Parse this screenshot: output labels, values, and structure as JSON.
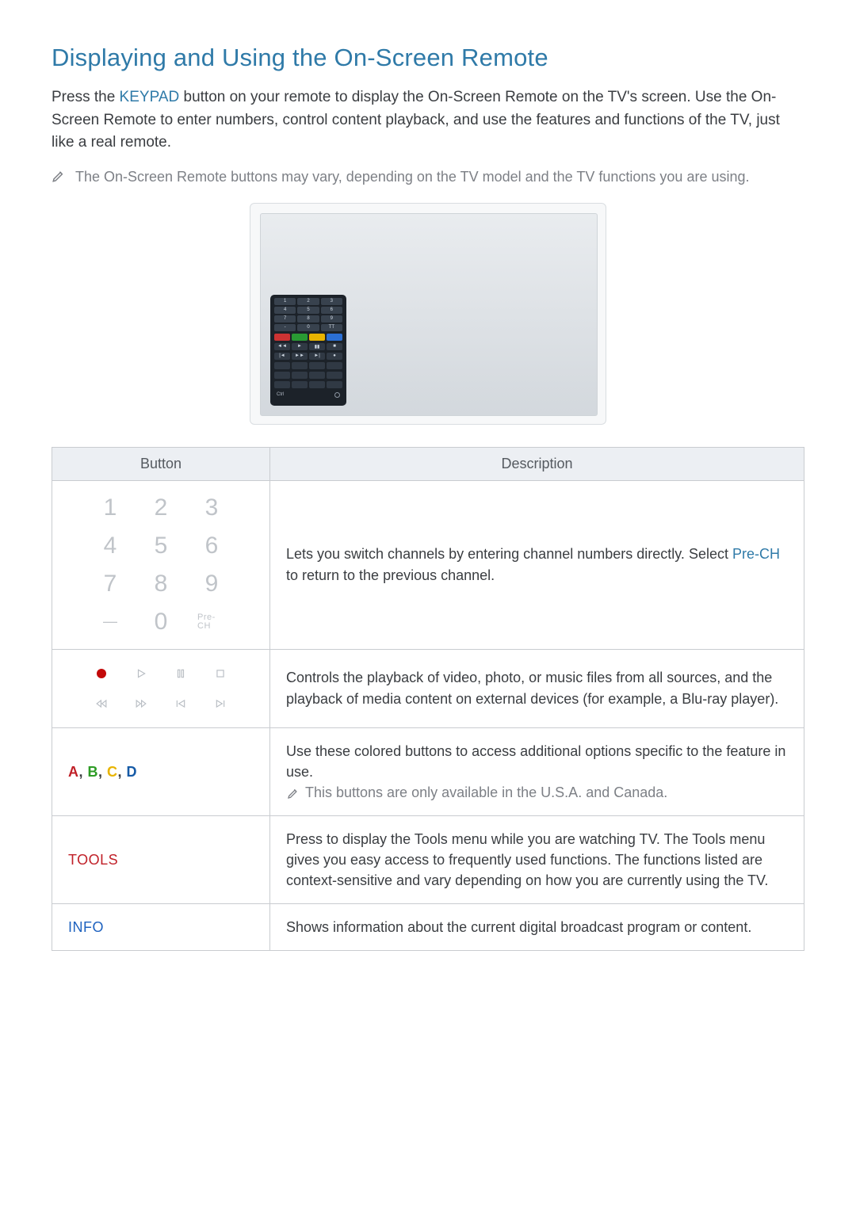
{
  "title": "Displaying and Using the On-Screen Remote",
  "intro_before_kw": "Press the ",
  "intro_kw": "KEYPAD",
  "intro_after_kw": " button on your remote to display the On-Screen Remote on the TV's screen. Use the On-Screen Remote to enter numbers, control content playback, and use the features and functions of the TV, just like a real remote.",
  "note": "The On-Screen Remote buttons may vary, depending on the TV model and the TV functions you are using.",
  "remote_numpad": [
    "1",
    "2",
    "3",
    "4",
    "5",
    "6",
    "7",
    "8",
    "9",
    "-",
    "0",
    "TT"
  ],
  "remote_foot_left": "Ctrl",
  "table": {
    "headers": {
      "button": "Button",
      "description": "Description"
    },
    "row_keypad": {
      "keys": [
        "1",
        "2",
        "3",
        "4",
        "5",
        "6",
        "7",
        "8",
        "9",
        "—",
        "0",
        "Pre-\nCH"
      ],
      "desc_before": "Lets you switch channels by entering channel numbers directly. Select ",
      "desc_kw": "Pre-CH",
      "desc_after": " to return to the previous channel."
    },
    "row_transport": {
      "desc": "Controls the playback of video, photo, or music files from all sources, and the playback of media content on external devices (for example, a Blu-ray player)."
    },
    "row_abcd": {
      "labels": {
        "a": "A",
        "b": "B",
        "c": "C",
        "d": "D"
      },
      "desc": "Use these colored buttons to access additional options specific to the feature in use.",
      "note": "This buttons are only available in the U.S.A. and Canada."
    },
    "row_tools": {
      "label": "TOOLS",
      "desc": "Press to display the Tools menu while you are watching TV. The Tools menu gives you easy access to frequently used functions. The functions listed are context-sensitive and vary depending on how you are currently using the TV."
    },
    "row_info": {
      "label": "INFO",
      "desc": "Shows information about the current digital broadcast program or content."
    }
  }
}
